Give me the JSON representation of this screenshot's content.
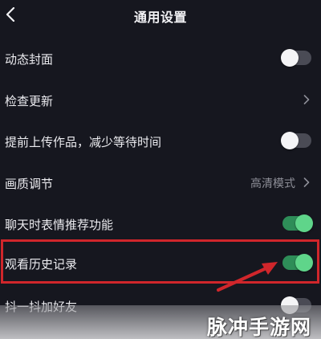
{
  "header": {
    "title": "通用设置"
  },
  "settings": [
    {
      "label": "动态封面",
      "control": "toggle",
      "state": "off"
    },
    {
      "label": "检查更新",
      "control": "chevron"
    },
    {
      "label": "提前上传作品，减少等待时间",
      "control": "toggle",
      "state": "off"
    },
    {
      "label": "画质调节",
      "control": "chevron",
      "value": "高清模式"
    },
    {
      "label": "聊天时表情推荐功能",
      "control": "toggle",
      "state": "on"
    },
    {
      "label": "观看历史记录",
      "control": "toggle",
      "state": "on",
      "highlighted": true
    },
    {
      "label": "抖一抖加好友",
      "control": "toggle",
      "state": "off"
    }
  ],
  "watermark": "脉冲手游网",
  "colors": {
    "background": "#16171f",
    "toggle_on": "#5fd58a",
    "toggle_off": "#4a4b55",
    "highlight": "#d0262b"
  }
}
